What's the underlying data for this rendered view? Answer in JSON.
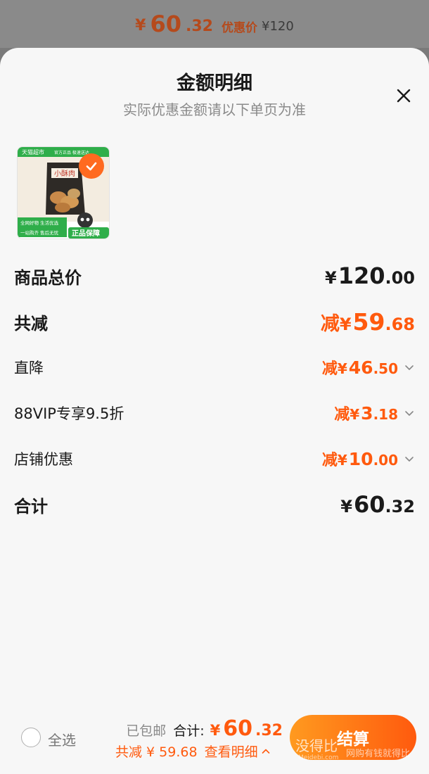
{
  "top_bar": {
    "yen": "¥",
    "price_int": "60",
    "price_dec": ".32",
    "label": "优惠价",
    "original": "¥120"
  },
  "sheet": {
    "title": "金额明细",
    "subtitle": "实际优惠金额请以下单页为准"
  },
  "rows": [
    {
      "label": "商品总价",
      "prefix": "",
      "yen": "¥",
      "int": "120",
      "dec": ".00",
      "style": "bold",
      "color": "dark",
      "expandable": false
    },
    {
      "label": "共减",
      "prefix": "减",
      "yen": "¥",
      "int": "59",
      "dec": ".68",
      "style": "bold",
      "color": "orange",
      "expandable": false
    },
    {
      "label": "直降",
      "prefix": "减",
      "yen": "¥",
      "int": "46",
      "dec": ".50",
      "style": "normal",
      "color": "orange",
      "expandable": true
    },
    {
      "label": "88VIP专享9.5折",
      "prefix": "减",
      "yen": "¥",
      "int": "3",
      "dec": ".18",
      "style": "normal",
      "color": "orange",
      "expandable": true
    },
    {
      "label": "店铺优惠",
      "prefix": "减",
      "yen": "¥",
      "int": "10",
      "dec": ".00",
      "style": "normal",
      "color": "orange",
      "expandable": true
    },
    {
      "label": "合计",
      "prefix": "",
      "yen": "¥",
      "int": "60",
      "dec": ".32",
      "style": "bold",
      "color": "dark",
      "expandable": false
    }
  ],
  "product": {
    "badge_store": "天猫超市",
    "badge_official": "官方正品 极速送达",
    "product_name": "小酥肉",
    "tag_line1": "全网好物 生活优选",
    "tag_line2": "一站购齐 售后无忧",
    "tag_guarantee": "正品保障",
    "selected": true
  },
  "bottom_bar": {
    "select_all": "全选",
    "shipping": "已包邮",
    "total_label": "合计:",
    "yen": "¥",
    "total_int": "60",
    "total_dec": ".32",
    "discount": "共减 ¥ 59.68",
    "view_detail": "查看明细",
    "checkout": "结算"
  },
  "watermark": {
    "main": "没得比",
    "site": "Meidebi.com",
    "tagline": "网购有钱就得比"
  },
  "colors": {
    "accent": "#ff5a0e",
    "accent_light": "#ff9a1f",
    "text": "#1a1a1a",
    "muted": "#8a8a8a",
    "tmall_green": "#2fae4a"
  }
}
